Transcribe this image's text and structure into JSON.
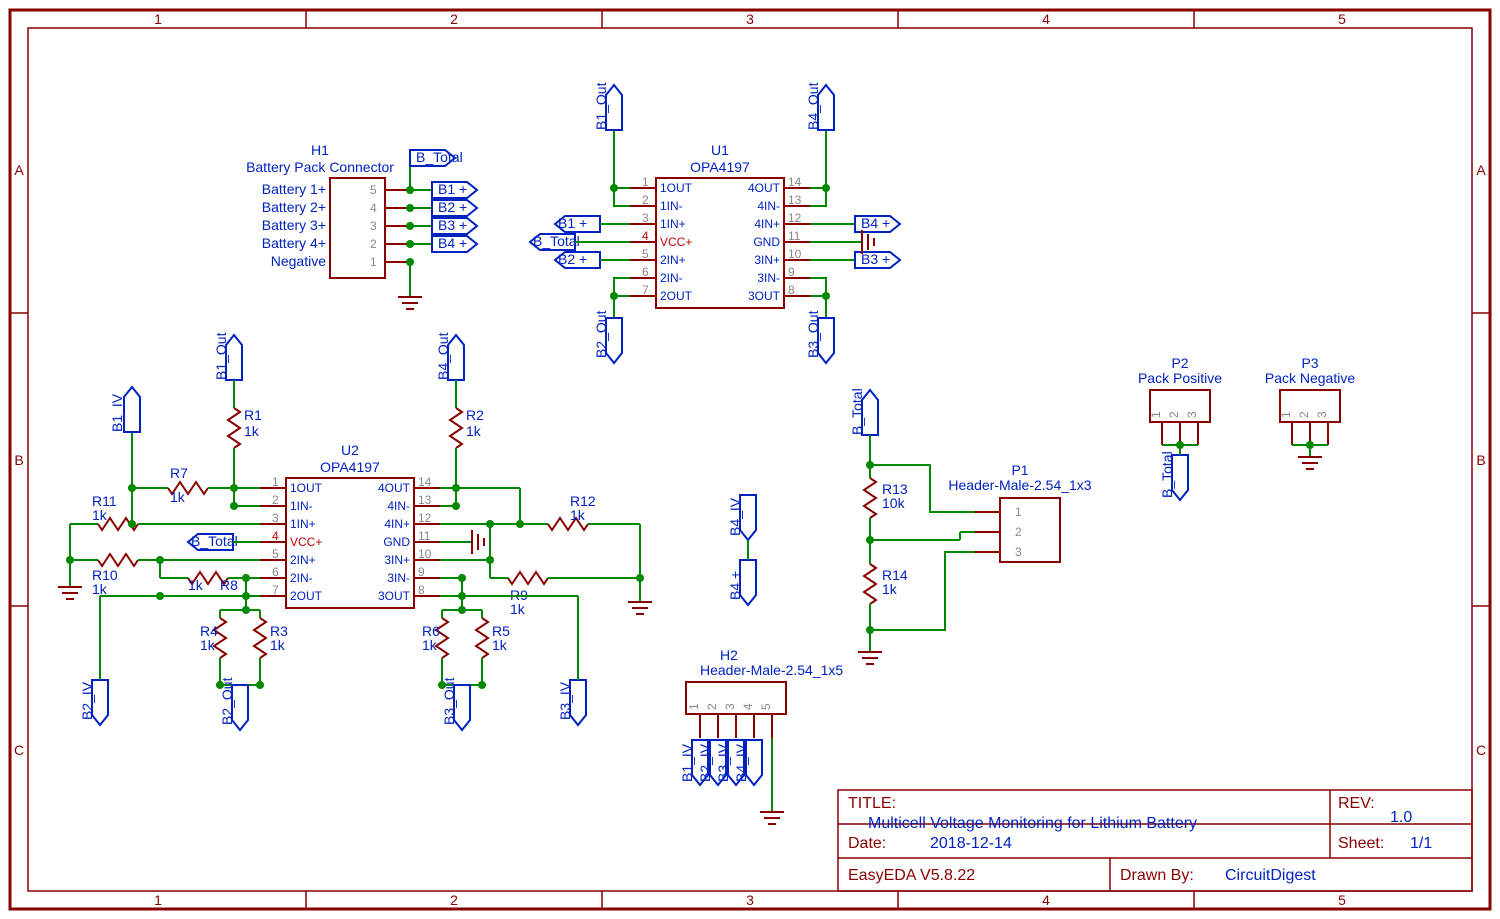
{
  "frame": {
    "cols": [
      "1",
      "2",
      "3",
      "4",
      "5"
    ],
    "rows": [
      "A",
      "B",
      "C"
    ]
  },
  "titleblock": {
    "title_label": "TITLE:",
    "title": "Multicell Voltage Monitoring for Lithium Battery",
    "rev_label": "REV:",
    "rev": "1.0",
    "date_label": "Date:",
    "date": "2018-12-14",
    "sheet_label": "Sheet:",
    "sheet": "1/1",
    "tool": "EasyEDA V5.8.22",
    "drawn_label": "Drawn By:",
    "drawn": "CircuitDigest"
  },
  "nets": {
    "b_total": "B_Total",
    "b1p": "B1 +",
    "b2p": "B2 +",
    "b3p": "B3 +",
    "b4p": "B4 +",
    "b1_out": "B1_Out",
    "b2_out": "B2_Out",
    "b3_out": "B3_Out",
    "b4_out": "B4_Out",
    "b1_iv": "B1_IV",
    "b2_iv": "B2_IV",
    "b3_iv": "B3_IV",
    "b4_iv": "B4_IV"
  },
  "H1": {
    "ref": "H1",
    "desc": "Battery Pack Connector",
    "rows": [
      "Battery 1+",
      "Battery 2+",
      "Battery 3+",
      "Battery 4+",
      "Negative"
    ],
    "pins": [
      "5",
      "4",
      "3",
      "2",
      "1"
    ]
  },
  "U": {
    "ref1": "U1",
    "ref2": "U2",
    "part": "OPA4197",
    "left": [
      [
        "1",
        "1OUT"
      ],
      [
        "2",
        "1IN-"
      ],
      [
        "3",
        "1IN+"
      ],
      [
        "4",
        "VCC+"
      ],
      [
        "5",
        "2IN+"
      ],
      [
        "6",
        "2IN-"
      ],
      [
        "7",
        "2OUT"
      ]
    ],
    "right": [
      [
        "14",
        "4OUT"
      ],
      [
        "13",
        "4IN-"
      ],
      [
        "12",
        "4IN+"
      ],
      [
        "11",
        "GND"
      ],
      [
        "10",
        "3IN+"
      ],
      [
        "9",
        "3IN-"
      ],
      [
        "8",
        "3OUT"
      ]
    ]
  },
  "R": {
    "r1": {
      "ref": "R1",
      "val": "1k"
    },
    "r2": {
      "ref": "R2",
      "val": "1k"
    },
    "r3": {
      "ref": "R3",
      "val": "1k"
    },
    "r4": {
      "ref": "R4",
      "val": "1k"
    },
    "r5": {
      "ref": "R5",
      "val": "1k"
    },
    "r6": {
      "ref": "R6",
      "val": "1k"
    },
    "r7": {
      "ref": "R7",
      "val": "1k"
    },
    "r8": {
      "ref": "R8",
      "val": "1k"
    },
    "r9": {
      "ref": "R9",
      "val": "1k"
    },
    "r10": {
      "ref": "R10",
      "val": "1k"
    },
    "r11": {
      "ref": "R11",
      "val": "1k"
    },
    "r12": {
      "ref": "R12",
      "val": "1k"
    },
    "r13": {
      "ref": "R13",
      "val": "10k"
    },
    "r14": {
      "ref": "R14",
      "val": "1k"
    }
  },
  "P1": {
    "ref": "P1",
    "desc": "Header-Male-2.54_1x3",
    "pins": [
      "1",
      "2",
      "3"
    ]
  },
  "P2": {
    "ref": "P2",
    "desc": "Pack Positive",
    "pins": [
      "1",
      "2",
      "3"
    ]
  },
  "P3": {
    "ref": "P3",
    "desc": "Pack Negative",
    "pins": [
      "1",
      "2",
      "3"
    ]
  },
  "H2": {
    "ref": "H2",
    "desc": "Header-Male-2.54_1x5",
    "pins": [
      "1",
      "2",
      "3",
      "4",
      "5"
    ]
  }
}
